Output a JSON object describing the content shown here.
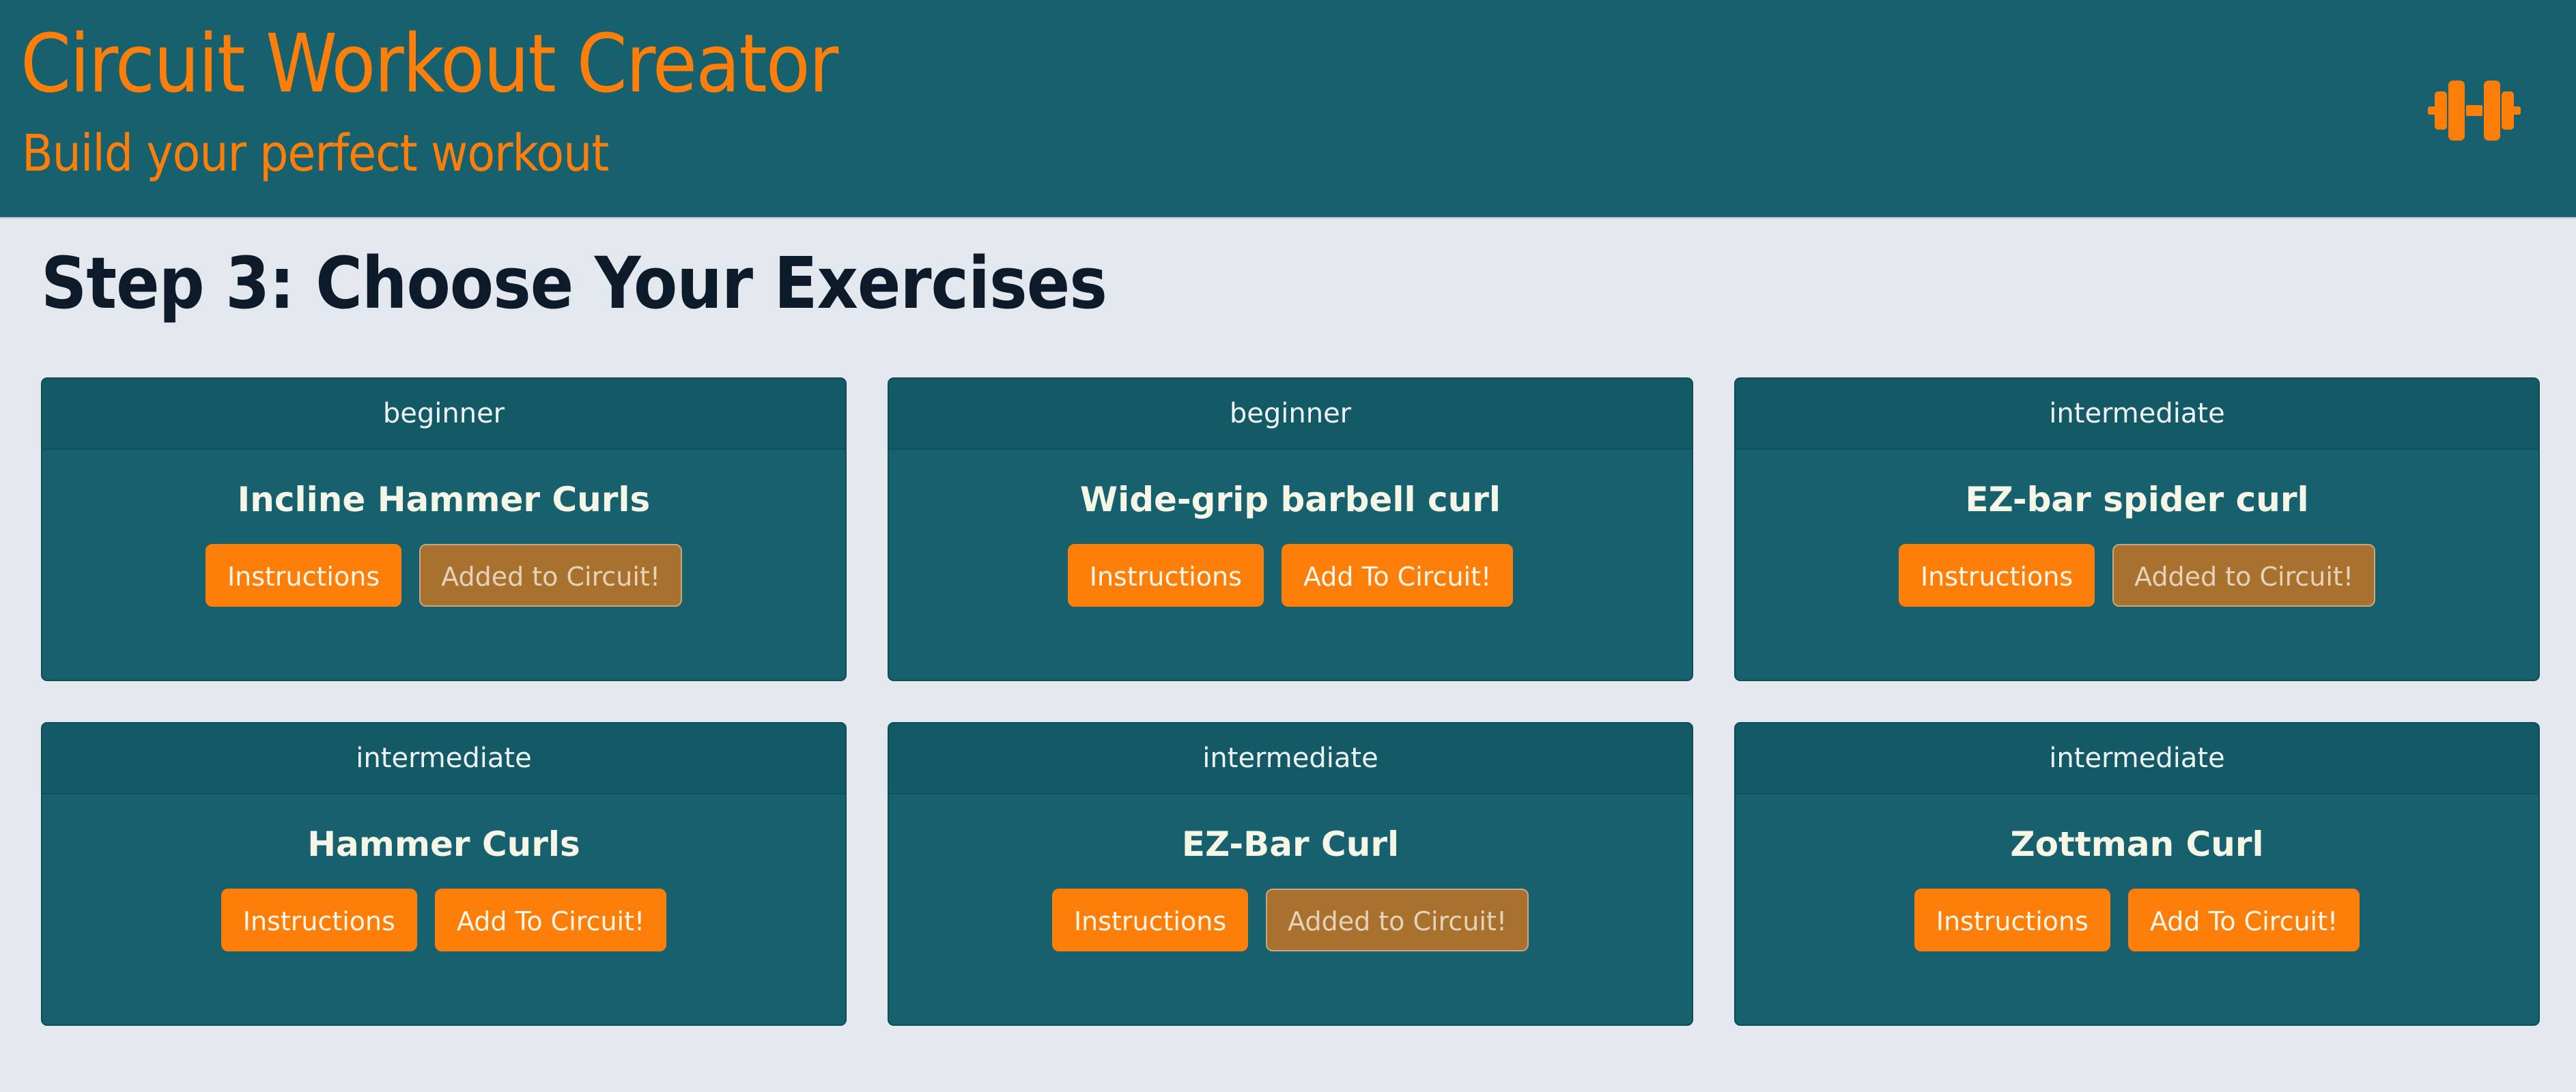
{
  "header": {
    "title": "Circuit Workout Creator",
    "subtitle": "Build your perfect workout",
    "logo_icon": "dumbbell-icon"
  },
  "main": {
    "step_title": "Step 3: Choose Your Exercises"
  },
  "colors": {
    "primary": "#17606e",
    "accent": "#fd7f0a",
    "background": "#e2e8ee",
    "added_button": "#a8712e"
  },
  "exercises": [
    {
      "level": "beginner",
      "name": "Incline Hammer Curls",
      "instructions_label": "Instructions",
      "circuit_label": "Added to Circuit!",
      "added": true
    },
    {
      "level": "beginner",
      "name": "Wide-grip barbell curl",
      "instructions_label": "Instructions",
      "circuit_label": "Add To Circuit!",
      "added": false
    },
    {
      "level": "intermediate",
      "name": "EZ-bar spider curl",
      "instructions_label": "Instructions",
      "circuit_label": "Added to Circuit!",
      "added": true
    },
    {
      "level": "intermediate",
      "name": "Hammer Curls",
      "instructions_label": "Instructions",
      "circuit_label": "Add To Circuit!",
      "added": false
    },
    {
      "level": "intermediate",
      "name": "EZ-Bar Curl",
      "instructions_label": "Instructions",
      "circuit_label": "Added to Circuit!",
      "added": true
    },
    {
      "level": "intermediate",
      "name": "Zottman Curl",
      "instructions_label": "Instructions",
      "circuit_label": "Add To Circuit!",
      "added": false
    }
  ]
}
